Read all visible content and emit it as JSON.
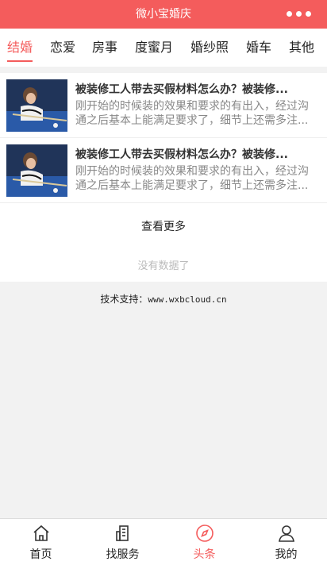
{
  "header": {
    "title": "微小宝婚庆"
  },
  "tabs": [
    {
      "label": "结婚",
      "active": true
    },
    {
      "label": "恋爱",
      "active": false
    },
    {
      "label": "房事",
      "active": false
    },
    {
      "label": "度蜜月",
      "active": false
    },
    {
      "label": "婚纱照",
      "active": false
    },
    {
      "label": "婚车",
      "active": false
    },
    {
      "label": "其他",
      "active": false
    }
  ],
  "articles": [
    {
      "title": "被装修工人带去买假材料怎么办？被装修...",
      "desc": "刚开始的时候装的效果和要求的有出入，经过沟通之后基本上能满足要求了，细节上还需多注...",
      "image": "billiards-player-photo"
    },
    {
      "title": "被装修工人带去买假材料怎么办？被装修...",
      "desc": "刚开始的时候装的效果和要求的有出入，经过沟通之后基本上能满足要求了，细节上还需多注...",
      "image": "billiards-player-photo"
    }
  ],
  "list": {
    "see_more": "查看更多",
    "no_data": "没有数据了"
  },
  "footer": {
    "support_label": "技术支持：",
    "support_url": "www.wxbcloud.cn"
  },
  "bottom_nav": [
    {
      "label": "首页",
      "icon": "home-icon",
      "active": false
    },
    {
      "label": "找服务",
      "icon": "building-icon",
      "active": false
    },
    {
      "label": "头条",
      "icon": "compass-icon",
      "active": true
    },
    {
      "label": "我的",
      "icon": "user-icon",
      "active": false
    }
  ],
  "colors": {
    "accent": "#f45c5c"
  }
}
